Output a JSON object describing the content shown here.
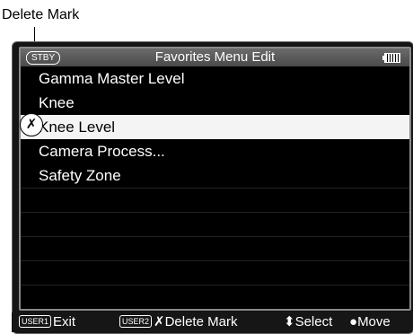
{
  "callout": {
    "label": "Delete Mark"
  },
  "header": {
    "status": "STBY",
    "title": "Favorites Menu Edit",
    "battery_icon": "battery-icon"
  },
  "menu": {
    "items": [
      {
        "label": "Gamma Master Level"
      },
      {
        "label": "Knee"
      },
      {
        "label": "Knee Level",
        "selected": true
      },
      {
        "label": "Camera Process..."
      },
      {
        "label": "Safety Zone"
      }
    ]
  },
  "delete_mark": {
    "glyph": "✗"
  },
  "footer": {
    "exit": {
      "badge": "USER1",
      "label": "Exit"
    },
    "delete": {
      "badge": "USER2",
      "label": "✗Delete Mark"
    },
    "select": {
      "glyph": "⬍",
      "label": "Select"
    },
    "move": {
      "glyph": "●",
      "label": "Move"
    }
  }
}
